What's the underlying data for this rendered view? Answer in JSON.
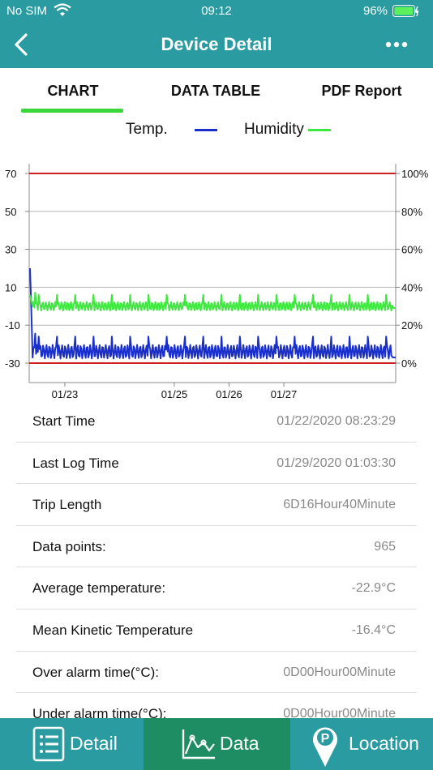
{
  "status_bar": {
    "carrier": "No SIM",
    "time": "09:12",
    "battery": "96%"
  },
  "nav": {
    "title": "Device Detail"
  },
  "tabs": [
    {
      "label": "CHART",
      "active": true
    },
    {
      "label": "DATA TABLE",
      "active": false
    },
    {
      "label": "PDF Report",
      "active": false
    }
  ],
  "legend": {
    "temp_label": "Temp.",
    "humidity_label": "Humidity"
  },
  "colors": {
    "header": "#2a9ba0",
    "temp_line": "#1a2fc9",
    "humidity_line": "#3ee83e",
    "alarm_line": "#cc1f1f",
    "tab_active": "#3ad63a",
    "bottom_active": "#1f8d64"
  },
  "chart_data": {
    "type": "line",
    "left_axis": {
      "ticks": [
        70,
        50,
        30,
        10,
        -10,
        -30
      ],
      "range": [
        -30,
        70
      ]
    },
    "right_axis": {
      "ticks": [
        "100%",
        "80%",
        "60%",
        "40%",
        "20%",
        "0%"
      ],
      "range": [
        0,
        100
      ]
    },
    "x_ticks": [
      "01/23",
      "01/25",
      "01/26",
      "01/27"
    ],
    "x_range": [
      "01/22 08:23",
      "01/29 01:03"
    ],
    "alarm_lines": {
      "upper": 70,
      "lower": -30
    },
    "grid": true,
    "legend_position": "top",
    "series": [
      {
        "name": "Temp.",
        "axis": "left",
        "baseline": -24,
        "amplitude": 4,
        "start_spike": 20,
        "periodic_peaks": -16,
        "end": -27
      },
      {
        "name": "Humidity",
        "axis": "right",
        "baseline": 30,
        "amplitude": 2.5,
        "start_spike": 36,
        "periodic_peaks": 36,
        "end": 29
      }
    ]
  },
  "details": [
    {
      "label": "Start Time",
      "value": "01/22/2020 08:23:29"
    },
    {
      "label": "Last Log Time",
      "value": "01/29/2020 01:03:30"
    },
    {
      "label": "Trip Length",
      "value": "6D16Hour40Minute"
    },
    {
      "label": "Data points:",
      "value": "965"
    },
    {
      "label": "Average temperature:",
      "value": "-22.9°C"
    },
    {
      "label": "Mean Kinetic Temperature",
      "value": "-16.4°C"
    },
    {
      "label": "Over alarm time(°C):",
      "value": "0D00Hour00Minute"
    },
    {
      "label": "Under alarm time(°C):",
      "value": "0D00Hour00Minute"
    }
  ],
  "bottom_nav": [
    {
      "label": "Detail",
      "icon": "list-icon",
      "active": false
    },
    {
      "label": "Data",
      "icon": "chart-icon",
      "active": true
    },
    {
      "label": "Location",
      "icon": "map-pin-icon",
      "active": false
    }
  ]
}
